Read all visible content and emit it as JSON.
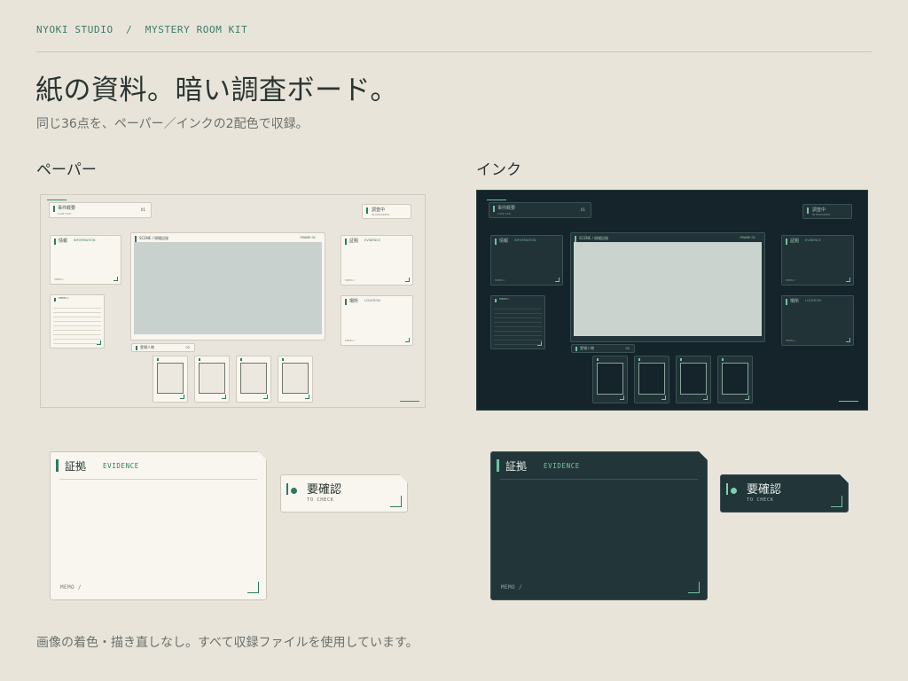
{
  "header": {
    "brand": "NYOKI STUDIO  /  MYSTERY ROOM KIT",
    "headline": "紙の資料。暗い調査ボード。",
    "subhead": "同じ36点を、ペーパー／インクの2配色で収録。"
  },
  "columns": {
    "paper_label": "ペーパー",
    "ink_label": "インク"
  },
  "board": {
    "case_summary": "事件概要",
    "case_summary_sub": "CASE FILE",
    "case_no": "01",
    "investigating": "調査中",
    "investigating_sub": "IN PROGRESS",
    "info": "情報",
    "info_sub": "INFORMATION",
    "evidence_small": "証拠",
    "evidence_small_sub": "EVIDENCE",
    "location": "場所",
    "location_sub": "LOCATION",
    "monitor_label": "SCENE /",
    "monitor_sub": "現場記録",
    "monitor_code": "FRAME 01",
    "people": "登場人物",
    "people_code": "02",
    "memo": "MEMO /"
  },
  "evidence_card": {
    "title": "証拠",
    "tag": "EVIDENCE",
    "memo": "MEMO /"
  },
  "check_card": {
    "title": "要確認",
    "tag": "TO CHECK"
  },
  "footer": "画像の着色・描き直しなし。すべて収録ファイルを使用しています。",
  "colors": {
    "background": "#e8e4da",
    "paper": "#f8f6ef",
    "ink": "#223538",
    "ink_board": "#14242a",
    "accent": "#2d7a66"
  }
}
